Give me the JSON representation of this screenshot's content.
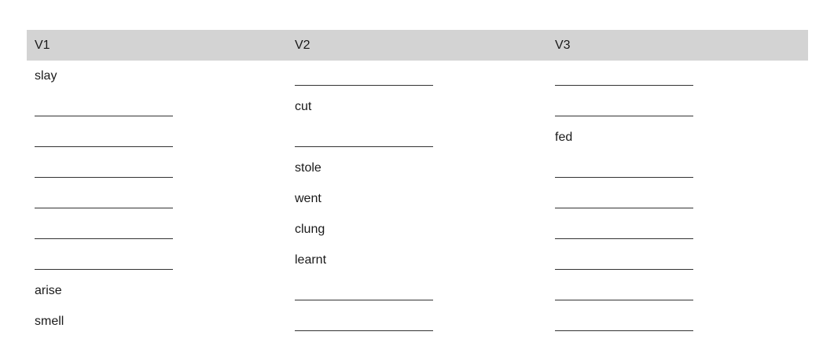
{
  "table": {
    "headers": [
      "V1",
      "V2",
      "V3"
    ],
    "rows": [
      [
        "slay",
        "",
        ""
      ],
      [
        "",
        "cut",
        ""
      ],
      [
        "",
        "",
        "fed"
      ],
      [
        "",
        "stole",
        ""
      ],
      [
        "",
        "went",
        ""
      ],
      [
        "",
        "clung",
        ""
      ],
      [
        "",
        "learnt",
        ""
      ],
      [
        "arise",
        "",
        ""
      ],
      [
        "smell",
        "",
        ""
      ]
    ]
  }
}
